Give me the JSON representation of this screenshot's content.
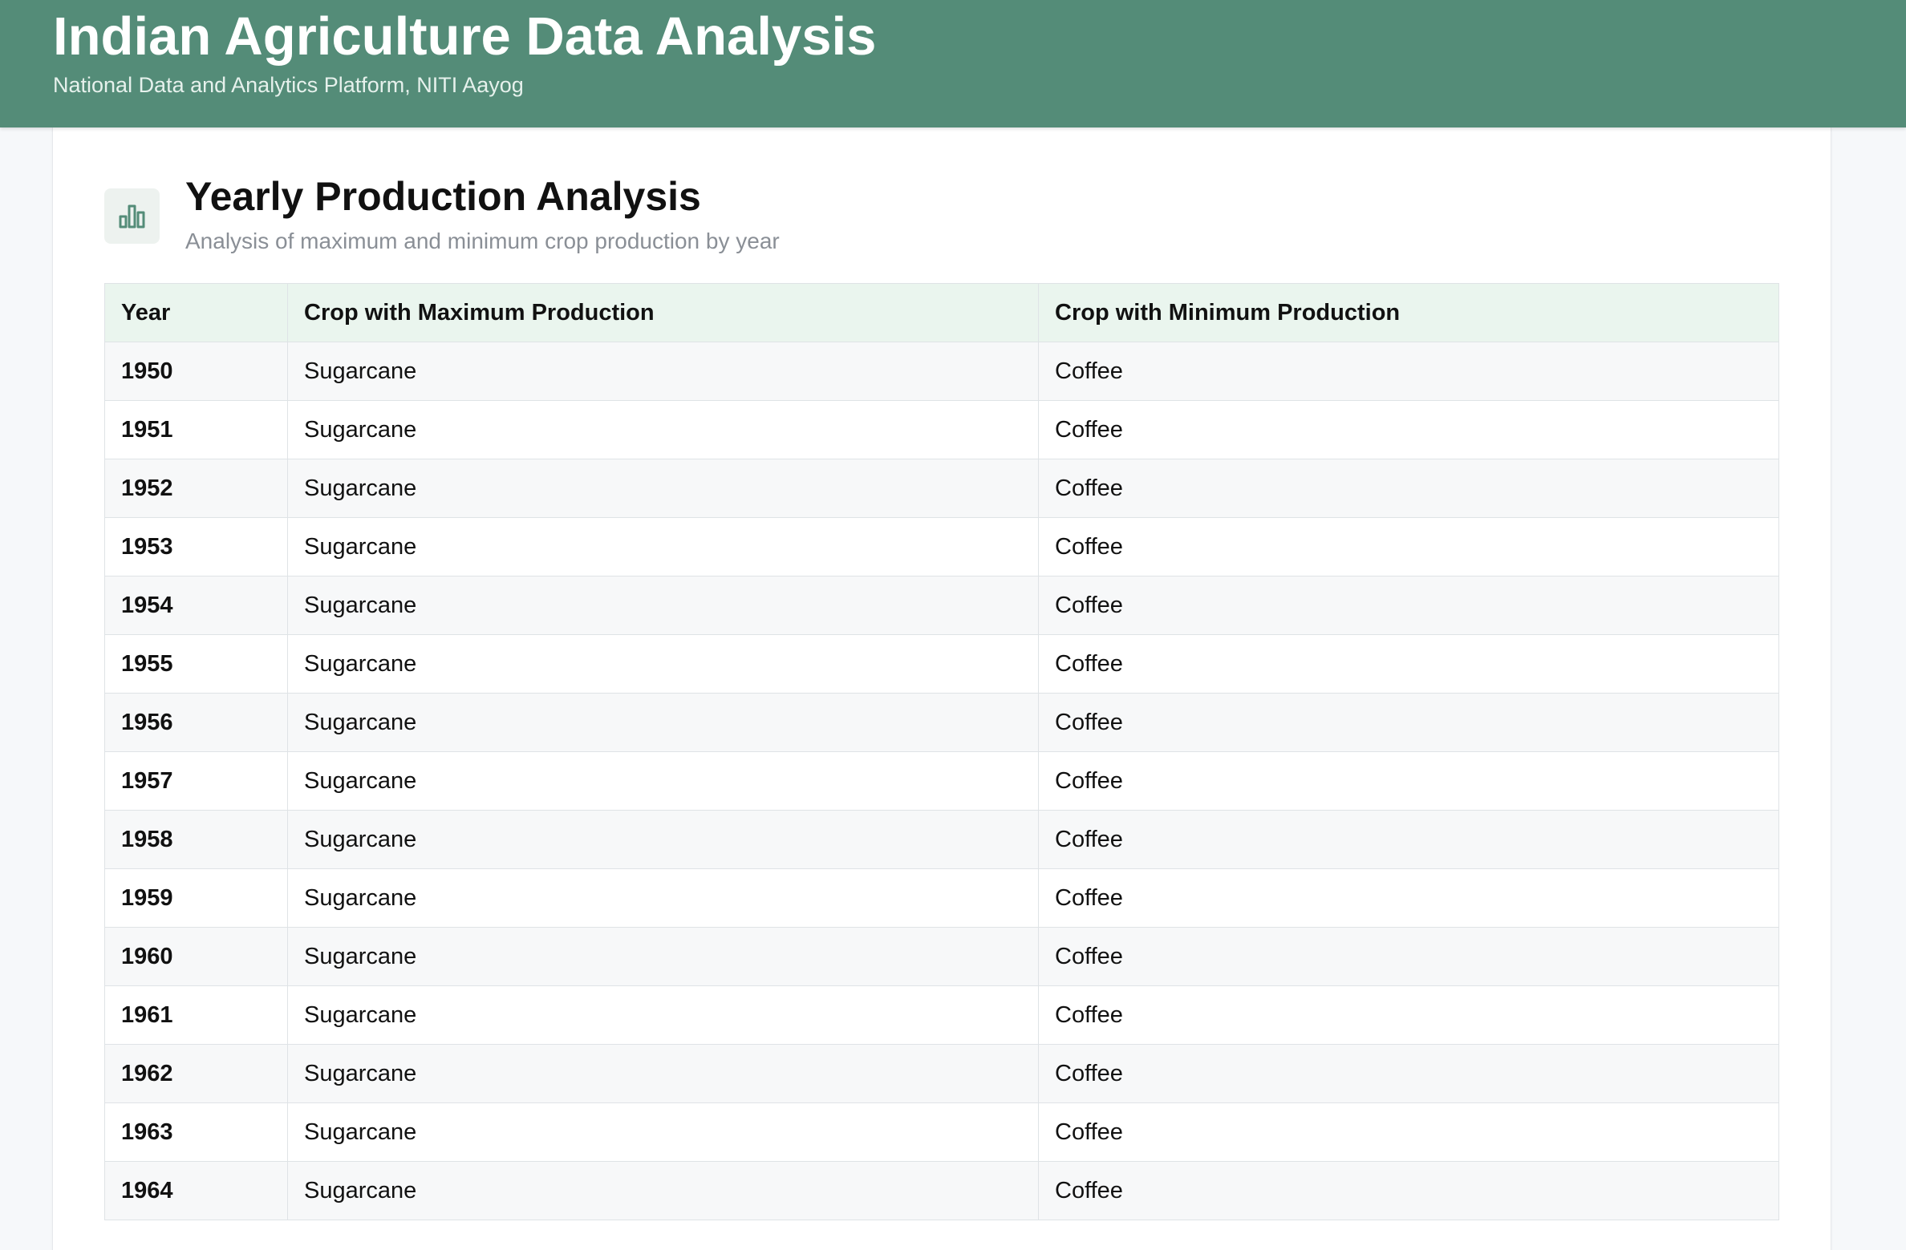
{
  "header": {
    "title": "Indian Agriculture Data Analysis",
    "subtitle": "National Data and Analytics Platform, NITI Aayog"
  },
  "section": {
    "icon": "bar-chart-icon",
    "title": "Yearly Production Analysis",
    "subtitle": "Analysis of maximum and minimum crop production by year"
  },
  "table": {
    "columns": [
      "Year",
      "Crop with Maximum Production",
      "Crop with Minimum Production"
    ],
    "rows": [
      {
        "year": "1950",
        "max": "Sugarcane",
        "min": "Coffee"
      },
      {
        "year": "1951",
        "max": "Sugarcane",
        "min": "Coffee"
      },
      {
        "year": "1952",
        "max": "Sugarcane",
        "min": "Coffee"
      },
      {
        "year": "1953",
        "max": "Sugarcane",
        "min": "Coffee"
      },
      {
        "year": "1954",
        "max": "Sugarcane",
        "min": "Coffee"
      },
      {
        "year": "1955",
        "max": "Sugarcane",
        "min": "Coffee"
      },
      {
        "year": "1956",
        "max": "Sugarcane",
        "min": "Coffee"
      },
      {
        "year": "1957",
        "max": "Sugarcane",
        "min": "Coffee"
      },
      {
        "year": "1958",
        "max": "Sugarcane",
        "min": "Coffee"
      },
      {
        "year": "1959",
        "max": "Sugarcane",
        "min": "Coffee"
      },
      {
        "year": "1960",
        "max": "Sugarcane",
        "min": "Coffee"
      },
      {
        "year": "1961",
        "max": "Sugarcane",
        "min": "Coffee"
      },
      {
        "year": "1962",
        "max": "Sugarcane",
        "min": "Coffee"
      },
      {
        "year": "1963",
        "max": "Sugarcane",
        "min": "Coffee"
      },
      {
        "year": "1964",
        "max": "Sugarcane",
        "min": "Coffee"
      }
    ]
  },
  "colors": {
    "header_bg": "#548c78",
    "table_header_bg": "#eaf5ee",
    "icon_stroke": "#548c78"
  }
}
